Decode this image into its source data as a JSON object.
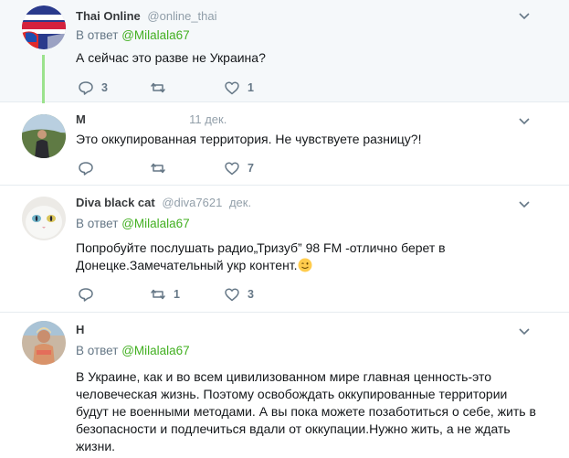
{
  "tweets": [
    {
      "name": "Thai Online",
      "handle": "@online_thai",
      "reply_label": "В ответ",
      "reply_mention": "@Milalala67",
      "text": "А сейчас это разве не Украина?",
      "replies": "3",
      "retweets": "",
      "likes": "1"
    },
    {
      "name": "М",
      "time": "11 дек.",
      "text": "Это оккупированная территория. Не чувствуете разницу?!",
      "replies": "",
      "retweets": "",
      "likes": "7"
    },
    {
      "name": "Diva black cat",
      "handle": "@diva7621",
      "time": "дек.",
      "reply_label": "В ответ",
      "reply_mention": "@Milalala67",
      "text_lines": [
        "Попробуйте послушать радио„Тризуб” 98 FM -отлично берет в",
        "Донецке.Замечательный укр контент."
      ],
      "replies": "",
      "retweets": "1",
      "likes": "3"
    },
    {
      "name": "Н",
      "reply_label": "В ответ",
      "reply_mention": "@Milalala67",
      "text_lines": [
        "В Украине, как и во всем цивилизованном мире главная ценность-это",
        "человеческая жизнь. Поэтому освобождать оккупированные территории",
        "будут не военными методами. А вы пока можете позаботиться о себе, жить в",
        "безопасности и подлечиться вдали от оккупации.Нужно жить, а не ждать",
        "жизни."
      ]
    }
  ],
  "icons": {
    "reply": "reply-icon",
    "retweet": "retweet-icon",
    "like": "heart-icon",
    "menu": "chevron-down-icon",
    "emoji": "winking-face-icon"
  },
  "colors": {
    "mention": "#43b022",
    "secondary_text": "#657786",
    "thread_line": "#9be28d",
    "highlight_bg": "#f5f8fa"
  }
}
